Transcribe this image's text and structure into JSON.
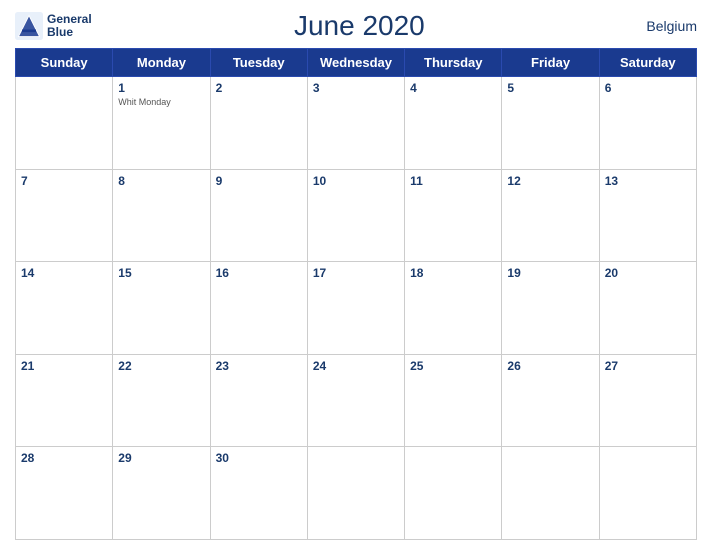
{
  "header": {
    "title": "June 2020",
    "country": "Belgium",
    "logo_line1": "General",
    "logo_line2": "Blue"
  },
  "days_of_week": [
    "Sunday",
    "Monday",
    "Tuesday",
    "Wednesday",
    "Thursday",
    "Friday",
    "Saturday"
  ],
  "weeks": [
    [
      {
        "num": "",
        "empty": true
      },
      {
        "num": "1",
        "holiday": "Whit Monday"
      },
      {
        "num": "2",
        "holiday": ""
      },
      {
        "num": "3",
        "holiday": ""
      },
      {
        "num": "4",
        "holiday": ""
      },
      {
        "num": "5",
        "holiday": ""
      },
      {
        "num": "6",
        "holiday": ""
      }
    ],
    [
      {
        "num": "7",
        "holiday": ""
      },
      {
        "num": "8",
        "holiday": ""
      },
      {
        "num": "9",
        "holiday": ""
      },
      {
        "num": "10",
        "holiday": ""
      },
      {
        "num": "11",
        "holiday": ""
      },
      {
        "num": "12",
        "holiday": ""
      },
      {
        "num": "13",
        "holiday": ""
      }
    ],
    [
      {
        "num": "14",
        "holiday": ""
      },
      {
        "num": "15",
        "holiday": ""
      },
      {
        "num": "16",
        "holiday": ""
      },
      {
        "num": "17",
        "holiday": ""
      },
      {
        "num": "18",
        "holiday": ""
      },
      {
        "num": "19",
        "holiday": ""
      },
      {
        "num": "20",
        "holiday": ""
      }
    ],
    [
      {
        "num": "21",
        "holiday": ""
      },
      {
        "num": "22",
        "holiday": ""
      },
      {
        "num": "23",
        "holiday": ""
      },
      {
        "num": "24",
        "holiday": ""
      },
      {
        "num": "25",
        "holiday": ""
      },
      {
        "num": "26",
        "holiday": ""
      },
      {
        "num": "27",
        "holiday": ""
      }
    ],
    [
      {
        "num": "28",
        "holiday": ""
      },
      {
        "num": "29",
        "holiday": ""
      },
      {
        "num": "30",
        "holiday": ""
      },
      {
        "num": "",
        "empty": true
      },
      {
        "num": "",
        "empty": true
      },
      {
        "num": "",
        "empty": true
      },
      {
        "num": "",
        "empty": true
      }
    ]
  ]
}
